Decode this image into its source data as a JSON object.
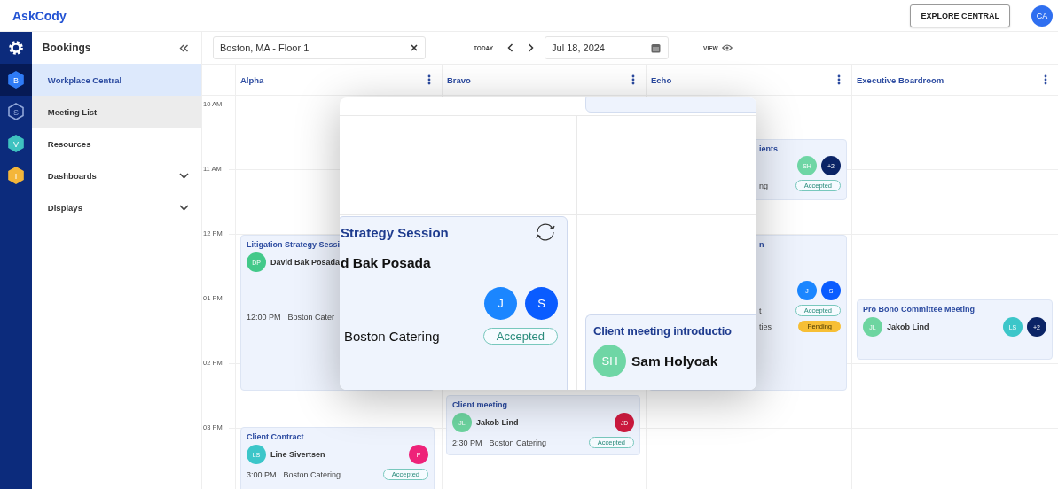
{
  "header": {
    "logo": "AskCody",
    "explore_button": "EXPLORE CENTRAL",
    "user_initials": "CA"
  },
  "rail": [
    {
      "kind": "gear",
      "selected": false
    },
    {
      "kind": "hex",
      "letter": "B",
      "color": "#2f7bf5",
      "selected": true
    },
    {
      "kind": "hex-outline",
      "letter": "S",
      "color": "#8fa6d8",
      "selected": false
    },
    {
      "kind": "hex",
      "letter": "V",
      "color": "#3fc2c0",
      "selected": false
    },
    {
      "kind": "hex",
      "letter": "I",
      "color": "#f4b63a",
      "selected": false
    }
  ],
  "sidebar": {
    "title": "Bookings",
    "items": [
      {
        "label": "Workplace Central",
        "kind": "link",
        "selected": true,
        "highlighted": false
      },
      {
        "label": "Meeting List",
        "kind": "link",
        "selected": false,
        "highlighted": true
      },
      {
        "label": "Resources",
        "kind": "link",
        "selected": false,
        "highlighted": false
      },
      {
        "label": "Dashboards",
        "kind": "group",
        "selected": false,
        "highlighted": false,
        "expanded": false
      },
      {
        "label": "Displays",
        "kind": "group",
        "selected": false,
        "highlighted": false,
        "expanded": false
      }
    ]
  },
  "toolbar": {
    "location": "Boston, MA - Floor 1",
    "today": "TODAY",
    "date": "Jul 18, 2024",
    "view": "VIEW"
  },
  "columns": [
    {
      "name": "Alpha"
    },
    {
      "name": "Bravo"
    },
    {
      "name": "Echo"
    },
    {
      "name": "Executive Boardroom"
    }
  ],
  "hours": [
    "10 AM",
    "11 AM",
    "12 PM",
    "01 PM",
    "02 PM",
    "03 PM"
  ],
  "events": [
    {
      "kind": "full",
      "title": "Litigation Strategy Sessi",
      "host": {
        "initials": "DP",
        "name": "David Bak Posada",
        "color": "#43c98a"
      },
      "time": "12:00 PM",
      "place": "Boston Cater"
    },
    {
      "kind": "full",
      "title": "Client Contract",
      "host": {
        "initials": "LS",
        "name": "Line Sivertsen",
        "color": "#3cc6c9"
      },
      "attendees": [
        {
          "initials": "P",
          "color": "#ee2279"
        }
      ],
      "time": "3:00 PM",
      "place": "Boston Catering",
      "status": "Accepted",
      "pending": false
    },
    {
      "kind": "full",
      "title": "Client meeting",
      "host": {
        "initials": "JL",
        "name": "Jakob Lind",
        "color": "#6dd5a0"
      },
      "attendees": [
        {
          "initials": "JD",
          "color": "#cf1a3f"
        }
      ],
      "time": "2:30 PM",
      "place": "Boston Catering",
      "status": "Accepted",
      "pending": false
    },
    {
      "kind": "fragment",
      "title": "ients",
      "attendees": [
        {
          "initials": "SH",
          "color": "#6fd6a5"
        },
        {
          "initials": "+2",
          "color": "#0b2466"
        }
      ],
      "rows": [
        {
          "text": "ng",
          "status": "Accepted",
          "pending": false
        }
      ]
    },
    {
      "kind": "fragment",
      "title": "n",
      "attendees": [
        {
          "initials": "J",
          "color": "#1b86ff"
        },
        {
          "initials": "S",
          "color": "#0a5cff"
        }
      ],
      "rows": [
        {
          "text": "t",
          "status": "Accepted",
          "pending": false
        },
        {
          "text": "ties",
          "status": "Pending",
          "pending": true
        }
      ]
    },
    {
      "kind": "full",
      "title": "Pro Bono Committee Meeting",
      "host": {
        "initials": "JL",
        "name": "Jakob Lind",
        "color": "#6dd5a0"
      },
      "attendees": [
        {
          "initials": "LS",
          "color": "#3cc6c9"
        },
        {
          "initials": "+2",
          "color": "#0b2466"
        }
      ]
    }
  ],
  "magnifier": {
    "cards": [
      {
        "title": "Strategy Session",
        "recurring": true,
        "host_name": "d Bak Posada",
        "attendees": [
          {
            "initials": "J",
            "color": "#1b86ff"
          },
          {
            "initials": "S",
            "color": "#0a5cff"
          }
        ],
        "place": "Boston Catering",
        "status": "Accepted",
        "pending": false
      },
      {
        "title": "Client meeting introductio",
        "recurring": false,
        "host": {
          "initials": "SH",
          "name": "Sam Holyoak",
          "color": "#6fd6a5"
        }
      }
    ]
  }
}
